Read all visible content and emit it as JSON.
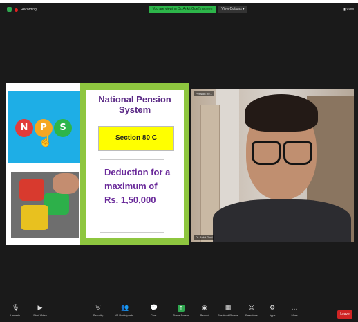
{
  "topbar": {
    "recording_label": "Recording",
    "viewing_banner": "You are viewing Dr. Ankit Goel's screen",
    "view_options": "View Options",
    "view_button": "View"
  },
  "slide": {
    "nps_letters": [
      "N",
      "P",
      "S"
    ],
    "title": "National Pension System",
    "section": "Section 80 C",
    "deduction_lines": [
      "Deduction for a",
      "maximum of",
      "Rs. 1,50,000"
    ]
  },
  "camera": {
    "top_label": "Pension Re...",
    "name_label": "Dr. Ankit Goel"
  },
  "toolbar": {
    "unmute": "Unmute",
    "start_video": "Start Video",
    "security": "Security",
    "participants": "Participants",
    "participants_count": "42",
    "chat": "Chat",
    "share_screen": "Share Screen",
    "record": "Record",
    "breakout_rooms": "Breakout Rooms",
    "reactions": "Reactions",
    "apps": "Apps",
    "more": "More",
    "leave": "Leave"
  },
  "colors": {
    "green_banner": "#2db54a",
    "slide_green": "#8ec63f",
    "title_purple": "#5b2a86",
    "yellow": "#ffff00",
    "leave_red": "#d02424"
  }
}
